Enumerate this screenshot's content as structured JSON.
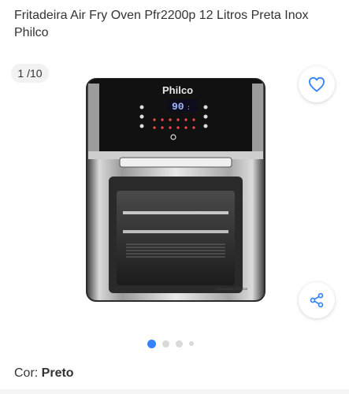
{
  "product": {
    "title": "Fritadeira Air Fry Oven Pfr2200p 12 Litros Preta Inox Philco",
    "brand_logo": "Philco",
    "display_value": "90",
    "capacity_mark": "Capacidade 12 litros"
  },
  "gallery": {
    "counter": "1 /10",
    "total_dots_visible": 4,
    "active_index": 0
  },
  "actions": {
    "favorite_icon": "heart-icon",
    "share_icon": "share-icon"
  },
  "variation": {
    "label": "Cor: ",
    "value": "Preto"
  },
  "colors": {
    "accent": "#3483fa",
    "text": "#333333"
  }
}
